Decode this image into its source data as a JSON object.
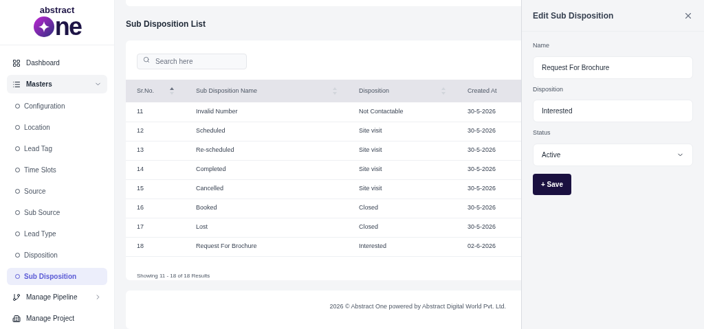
{
  "logo": {
    "top": "abstract",
    "bottom": "ne"
  },
  "sidebar": {
    "items": [
      {
        "label": "Dashboard",
        "kind": "grid",
        "selected": false
      },
      {
        "label": "Masters",
        "kind": "list",
        "selected": false,
        "expanded": true,
        "children": [
          {
            "label": "Configuration",
            "selected": false
          },
          {
            "label": "Location",
            "selected": false
          },
          {
            "label": "Lead Tag",
            "selected": false
          },
          {
            "label": "Time Slots",
            "selected": false
          },
          {
            "label": "Source",
            "selected": false
          },
          {
            "label": "Sub Source",
            "selected": false
          },
          {
            "label": "Lead Type",
            "selected": false
          },
          {
            "label": "Disposition",
            "selected": false
          },
          {
            "label": "Sub Disposition",
            "selected": true
          }
        ]
      },
      {
        "label": "Manage Pipeline",
        "kind": "pipeline",
        "selected": false,
        "expanded": false
      },
      {
        "label": "Manage Project",
        "kind": "building",
        "selected": false
      }
    ]
  },
  "page_title": "Sub Disposition List",
  "search": {
    "placeholder": "Search here"
  },
  "table": {
    "columns": [
      {
        "label": "Sr.No.",
        "sorted": true
      },
      {
        "label": "Sub Disposition Name",
        "sorted": false
      },
      {
        "label": "Disposition",
        "sorted": false
      },
      {
        "label": "Created At"
      }
    ],
    "rows": [
      [
        "11",
        "Invalid Number",
        "Not Contactable",
        "30-5-2026"
      ],
      [
        "12",
        "Scheduled",
        "Site visit",
        "30-5-2026"
      ],
      [
        "13",
        "Re-scheduled",
        "Site visit",
        "30-5-2026"
      ],
      [
        "14",
        "Completed",
        "Site visit",
        "30-5-2026"
      ],
      [
        "15",
        "Cancelled",
        "Site visit",
        "30-5-2026"
      ],
      [
        "16",
        "Booked",
        "Closed",
        "30-5-2026"
      ],
      [
        "17",
        "Lost",
        "Closed",
        "30-5-2026"
      ],
      [
        "18",
        "Request For Brochure",
        "Interested",
        "02-6-2026"
      ]
    ]
  },
  "pagination_info": "Showing 11 - 18 of 18 Results",
  "footer": "2026 © Abstract One powered by Abstract Digital World Pvt. Ltd.",
  "panel": {
    "title": "Edit Sub Disposition",
    "fields": [
      {
        "label": "Name",
        "kind": "text",
        "value": "Request For Brochure"
      },
      {
        "label": "Disposition",
        "kind": "text",
        "value": "Interested"
      },
      {
        "label": "Status",
        "kind": "select",
        "value": "Active"
      }
    ],
    "save_button": "+ Save"
  }
}
